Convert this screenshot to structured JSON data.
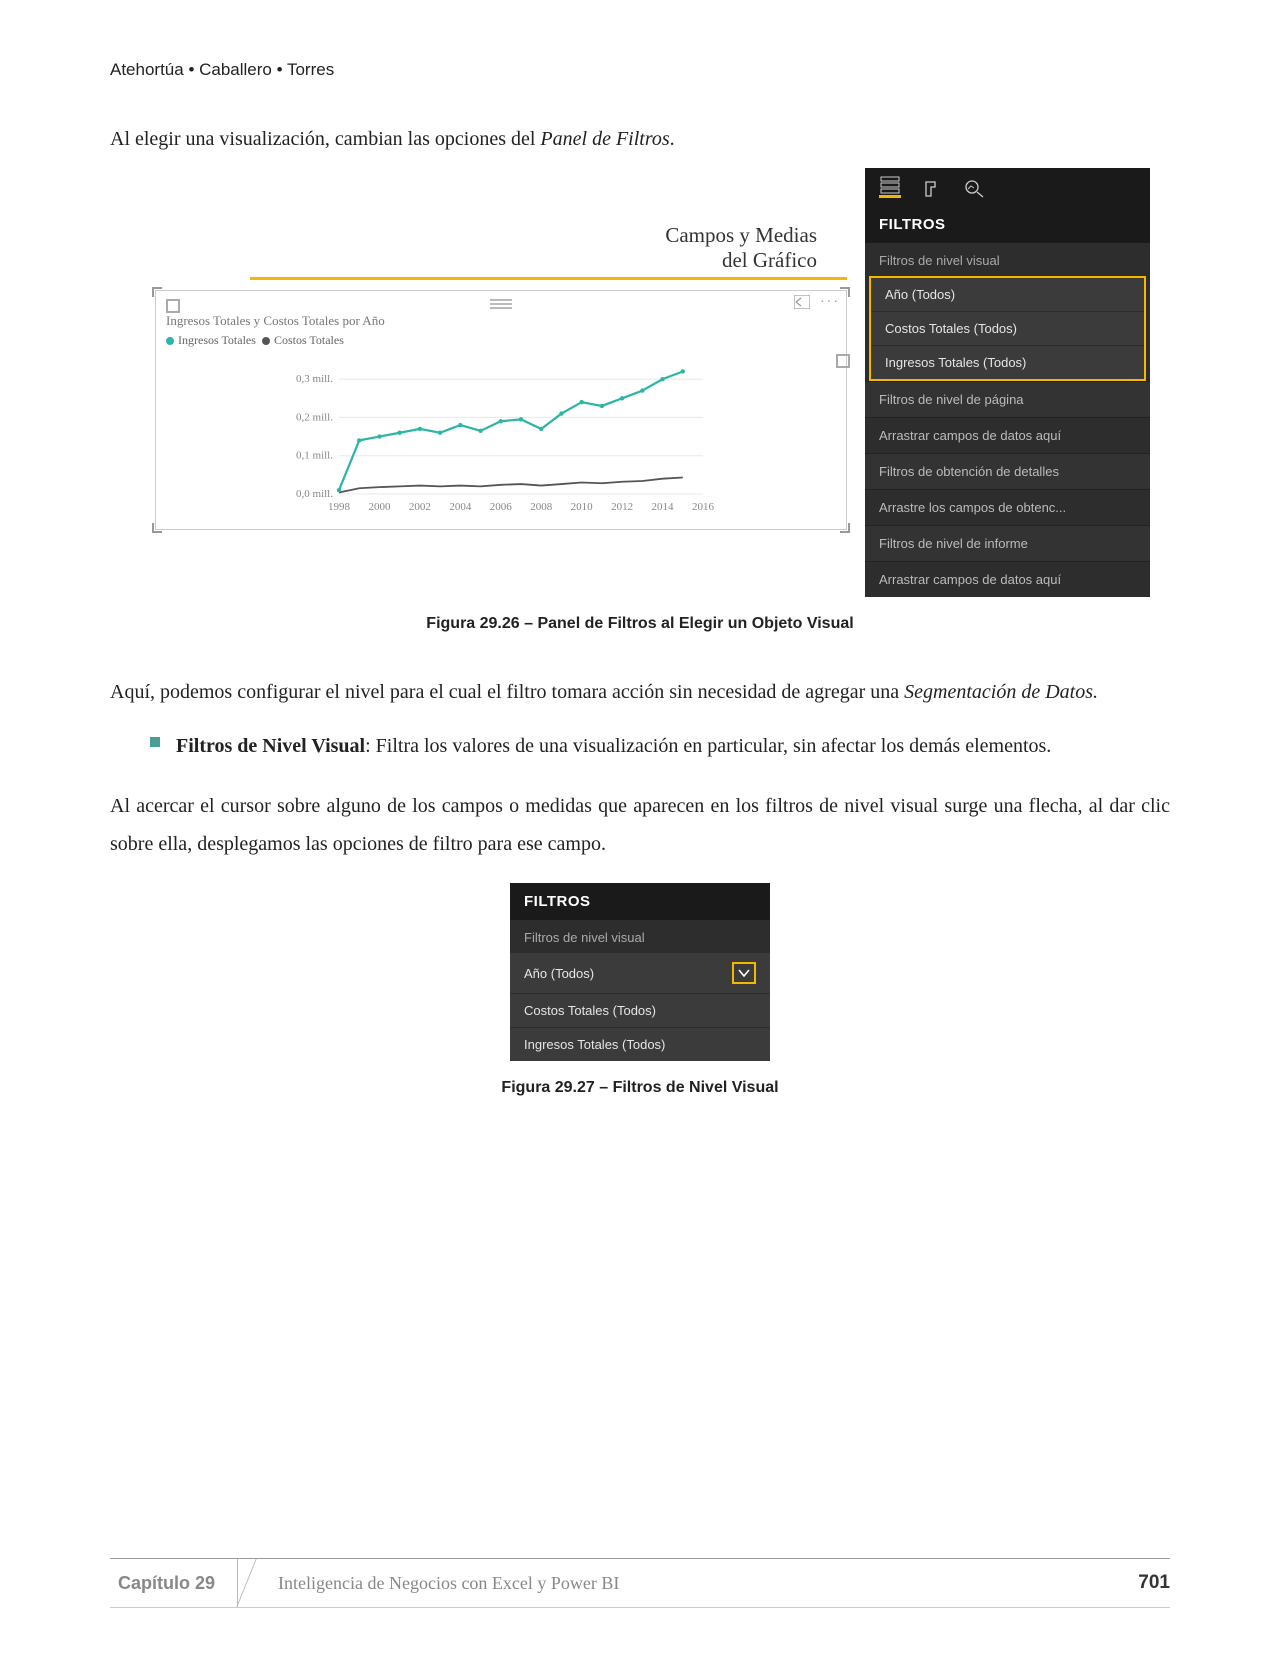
{
  "header": {
    "authors": "Atehortúa • Caballero • Torres"
  },
  "intro": {
    "text1": "Al elegir una visualización, cambian las opciones del ",
    "italic1": "Panel de Filtros",
    "text2": "."
  },
  "annotation": {
    "line1": "Campos y Medias",
    "line2": "del Gráfico"
  },
  "chart": {
    "title": "Ingresos Totales y Costos Totales por Año",
    "legend1": "Ingresos Totales",
    "legend2": "Costos Totales"
  },
  "chart_data": {
    "type": "line",
    "title": "Ingresos Totales y Costos Totales por Año",
    "xlabel": "",
    "ylabel": "",
    "ylim": [
      0,
      0.35
    ],
    "y_unit": "mill.",
    "x": [
      1998,
      1999,
      2000,
      2001,
      2002,
      2003,
      2004,
      2005,
      2006,
      2007,
      2008,
      2009,
      2010,
      2011,
      2012,
      2013,
      2014,
      2015
    ],
    "x_ticks": [
      1998,
      2000,
      2002,
      2004,
      2006,
      2008,
      2010,
      2012,
      2014,
      2016
    ],
    "y_ticks": [
      "0,0 mill.",
      "0,1 mill.",
      "0,2 mill.",
      "0,3 mill."
    ],
    "series": [
      {
        "name": "Ingresos Totales",
        "color": "#2db5a5",
        "values": [
          0.01,
          0.14,
          0.15,
          0.16,
          0.17,
          0.16,
          0.18,
          0.165,
          0.19,
          0.195,
          0.17,
          0.21,
          0.24,
          0.23,
          0.25,
          0.27,
          0.3,
          0.32
        ]
      },
      {
        "name": "Costos Totales",
        "color": "#555555",
        "values": [
          0.004,
          0.015,
          0.018,
          0.02,
          0.022,
          0.02,
          0.022,
          0.02,
          0.024,
          0.026,
          0.022,
          0.026,
          0.03,
          0.028,
          0.032,
          0.034,
          0.04,
          0.043
        ]
      }
    ]
  },
  "panel1": {
    "heading": "FILTROS",
    "sub_visual": "Filtros de nivel visual",
    "items": [
      "Año (Todos)",
      "Costos Totales (Todos)",
      "Ingresos Totales (Todos)"
    ],
    "row_page": "Filtros de nivel de página",
    "row_drag1": "Arrastrar campos de datos aquí",
    "row_drill": "Filtros de obtención de detalles",
    "row_drag2": "Arrastre los campos de obtenc...",
    "row_report": "Filtros de nivel de informe",
    "row_drag3": "Arrastrar campos de datos aquí"
  },
  "caption1": "Figura 29.26 –  Panel de Filtros al Elegir un Objeto Visual",
  "para2": {
    "t1": "Aquí, podemos configurar el nivel para el cual el filtro tomara acción sin necesidad de agregar una ",
    "i1": "Segmentación de Datos.",
    "t2": ""
  },
  "bullet": {
    "bold": "Filtros de Nivel Visual",
    "rest": ": Filtra los valores de una visualización en particular, sin afectar los demás elementos."
  },
  "para3": "Al acercar el cursor sobre alguno de los campos o medidas que aparecen en los filtros de nivel visual surge una flecha, al dar clic sobre ella, desplegamos las opciones de filtro para ese campo.",
  "panel2": {
    "heading": "FILTROS",
    "sub_visual": "Filtros de nivel visual",
    "items": [
      "Año (Todos)",
      "Costos Totales (Todos)",
      "Ingresos Totales (Todos)"
    ]
  },
  "caption2": "Figura 29.27 –  Filtros de Nivel Visual",
  "footer": {
    "chapter": "Capítulo 29",
    "title": "Inteligencia de Negocios con Excel y Power BI",
    "page": "701"
  }
}
